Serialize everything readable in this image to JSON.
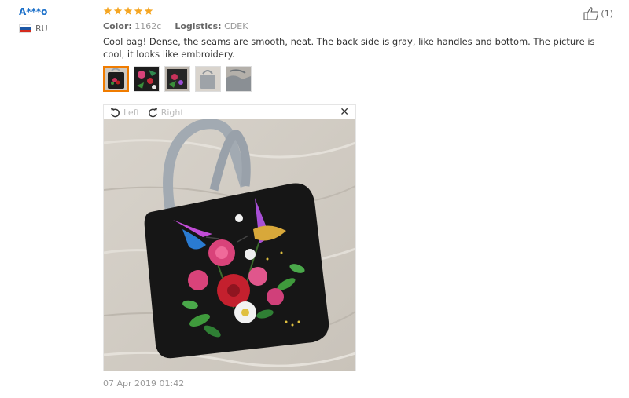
{
  "review": {
    "username": "A***o",
    "country": "RU",
    "rating": 5,
    "color_label": "Color:",
    "color_value": "1162c",
    "logistics_label": "Logistics:",
    "logistics_value": "CDEK",
    "text": "Cool bag! Dense, the seams are smooth, neat. The back side is gray, like handles and bottom. The picture is cool, it looks like embroidery.",
    "like_count": "(1)",
    "date": "07 Apr 2019 01:42"
  },
  "viewer": {
    "rotate_left_label": "Left",
    "rotate_right_label": "Right",
    "close_glyph": "✕"
  },
  "colors": {
    "star": "#f5a623",
    "username": "#1a6fc9",
    "active_thumb": "#f07c00"
  },
  "icons": {
    "like": "thumbs-up-icon",
    "rotate_left": "rotate-left-icon",
    "rotate_right": "rotate-right-icon",
    "close": "close-icon",
    "flag": "russia-flag-icon",
    "star": "star-icon"
  }
}
